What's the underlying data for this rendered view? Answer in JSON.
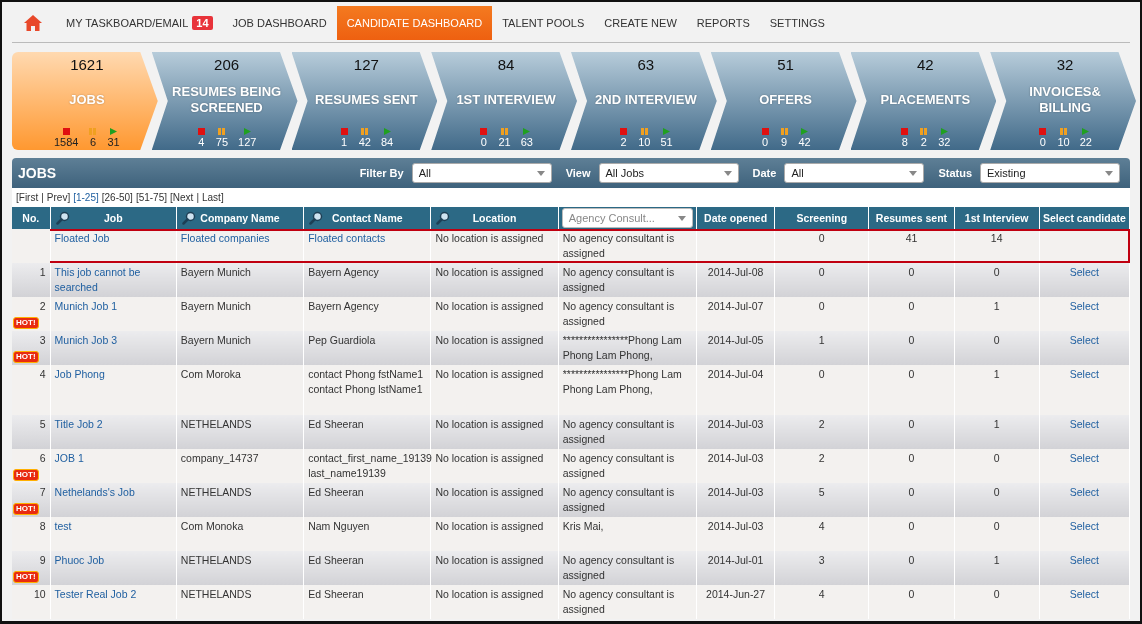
{
  "nav": {
    "items": [
      {
        "label": "MY TASKBOARD/EMAIL",
        "badge": "14",
        "selected": false
      },
      {
        "label": "JOB DASHBOARD",
        "selected": false
      },
      {
        "label": "CANDIDATE DASHBOARD",
        "selected": true
      },
      {
        "label": "TALENT POOLS",
        "selected": false
      },
      {
        "label": "CREATE NEW",
        "selected": false
      },
      {
        "label": "REPORTS",
        "selected": false
      },
      {
        "label": "SETTINGS",
        "selected": false
      }
    ]
  },
  "pipeline": [
    {
      "count": "1621",
      "label": "JOBS",
      "stopped": "1584",
      "paused": "6",
      "active": "31",
      "selected": true
    },
    {
      "count": "206",
      "label": "RESUMES BEING SCREENED",
      "stopped": "4",
      "paused": "75",
      "active": "127",
      "selected": false
    },
    {
      "count": "127",
      "label": "RESUMES SENT",
      "stopped": "1",
      "paused": "42",
      "active": "84",
      "selected": false
    },
    {
      "count": "84",
      "label": "1ST INTERVIEW",
      "stopped": "0",
      "paused": "21",
      "active": "63",
      "selected": false
    },
    {
      "count": "63",
      "label": "2ND INTERVIEW",
      "stopped": "2",
      "paused": "10",
      "active": "51",
      "selected": false
    },
    {
      "count": "51",
      "label": "OFFERS",
      "stopped": "0",
      "paused": "9",
      "active": "42",
      "selected": false
    },
    {
      "count": "42",
      "label": "PLACEMENTS",
      "stopped": "8",
      "paused": "2",
      "active": "32",
      "selected": false
    },
    {
      "count": "32",
      "label": "INVOICES& BILLING",
      "stopped": "0",
      "paused": "10",
      "active": "22",
      "selected": false
    }
  ],
  "panel": {
    "title": "JOBS",
    "filters": [
      {
        "label": "Filter By",
        "value": "All"
      },
      {
        "label": "View",
        "value": "All Jobs"
      },
      {
        "label": "Date",
        "value": "All"
      },
      {
        "label": "Status",
        "value": "Existing"
      }
    ],
    "pager": {
      "separator": "|",
      "items": [
        {
          "label": "[First",
          "selected": false
        },
        {
          "label": "Prev]",
          "selected": false
        },
        {
          "label": "[1-25]",
          "selected": true
        },
        {
          "label": "[26-50]",
          "selected": false
        },
        {
          "label": "[51-75]",
          "selected": false
        },
        {
          "label": "[Next",
          "selected": false
        },
        {
          "label": "Last]",
          "selected": false
        }
      ]
    },
    "table": {
      "columns": [
        {
          "label": "No.",
          "kind": "plain"
        },
        {
          "label": "Job",
          "kind": "search"
        },
        {
          "label": "Company Name",
          "kind": "search"
        },
        {
          "label": "Contact Name",
          "kind": "search"
        },
        {
          "label": "Location",
          "kind": "search"
        },
        {
          "label": "Agency Consult...",
          "kind": "dropdown"
        },
        {
          "label": "Date opened",
          "kind": "plain"
        },
        {
          "label": "Screening",
          "kind": "plain"
        },
        {
          "label": "Resumes sent",
          "kind": "plain"
        },
        {
          "label": "1st Interview",
          "kind": "plain"
        },
        {
          "label": "Select candidate",
          "kind": "plain"
        }
      ],
      "rows": [
        {
          "no": "",
          "job": "Floated Job",
          "company": "Floated companies",
          "company_link": true,
          "contact": "Floated contacts",
          "contact_link": true,
          "location": "No location is assigned",
          "consultant": "No agency consultant is assigned",
          "date": "",
          "screening": "0",
          "resumes_sent": "41",
          "first_interview": "14",
          "select": "",
          "highlighted": true
        },
        {
          "no": "1",
          "job": "This job cannot be searched",
          "company": "Bayern Munich",
          "contact": "Bayern Agency",
          "location": "No location is assigned",
          "consultant": "No agency consultant is assigned",
          "date": "2014-Jul-08",
          "screening": "0",
          "resumes_sent": "0",
          "first_interview": "0",
          "select": "Select",
          "highlighted": false
        },
        {
          "no": "2",
          "badge": "HOT!",
          "job": "Munich Job 1",
          "company": "Bayern Munich",
          "contact": "Bayern Agency",
          "location": "No location is assigned",
          "consultant": "No agency consultant is assigned",
          "date": "2014-Jul-07",
          "screening": "0",
          "resumes_sent": "0",
          "first_interview": "1",
          "select": "Select",
          "highlighted": false
        },
        {
          "no": "3",
          "badge": "HOT!",
          "job": "Munich Job 3",
          "company": "Bayern Munich",
          "contact": "Pep Guardiola",
          "location": "No location is assigned",
          "consultant": "****************Phong Lam Phong Lam Phong,",
          "date": "2014-Jul-05",
          "screening": "1",
          "resumes_sent": "0",
          "first_interview": "0",
          "select": "Select",
          "highlighted": false
        },
        {
          "no": "4",
          "job": "Job Phong",
          "company": "Com Moroka",
          "contact": "contact Phong fstName1 contact Phong lstName1",
          "location": "No location is assigned",
          "consultant": "****************Phong Lam Phong Lam Phong,",
          "date": "2014-Jul-04",
          "screening": "0",
          "resumes_sent": "0",
          "first_interview": "1",
          "select": "Select",
          "highlighted": false
        },
        {
          "no": "5",
          "job": "Title Job 2",
          "company": "NETHELANDS",
          "contact": "Ed Sheeran",
          "location": "No location is assigned",
          "consultant": "No agency consultant is assigned",
          "date": "2014-Jul-03",
          "screening": "2",
          "resumes_sent": "0",
          "first_interview": "1",
          "select": "Select",
          "highlighted": false
        },
        {
          "no": "6",
          "badge": "HOT!",
          "job": "JOB 1",
          "company": "company_14737",
          "contact": "contact_first_name_19139 last_name19139",
          "location": "No location is assigned",
          "consultant": "No agency consultant is assigned",
          "date": "2014-Jul-03",
          "screening": "2",
          "resumes_sent": "0",
          "first_interview": "0",
          "select": "Select",
          "highlighted": false
        },
        {
          "no": "7",
          "badge": "HOT!",
          "job": "Nethelands's Job",
          "company": "NETHELANDS",
          "contact": "Ed Sheeran",
          "location": "No location is assigned",
          "consultant": "No agency consultant is assigned",
          "date": "2014-Jul-03",
          "screening": "5",
          "resumes_sent": "0",
          "first_interview": "0",
          "select": "Select",
          "highlighted": false
        },
        {
          "no": "8",
          "job": "test",
          "company": "Com Monoka",
          "contact": "Nam Nguyen",
          "location": "No location is assigned",
          "consultant": "Kris Mai,",
          "date": "2014-Jul-03",
          "screening": "4",
          "resumes_sent": "0",
          "first_interview": "0",
          "select": "Select",
          "highlighted": false
        },
        {
          "no": "9",
          "badge": "HOT!",
          "job": "Phuoc Job",
          "company": "NETHELANDS",
          "contact": "Ed Sheeran",
          "location": "No location is assigned",
          "consultant": "No agency consultant is assigned",
          "date": "2014-Jul-01",
          "screening": "3",
          "resumes_sent": "0",
          "first_interview": "1",
          "select": "Select",
          "highlighted": false
        },
        {
          "no": "10",
          "job": "Tester Real Job 2",
          "company": "NETHELANDS",
          "contact": "Ed Sheeran",
          "location": "No location is assigned",
          "consultant": "No agency consultant is assigned",
          "date": "2014-Jun-27",
          "screening": "4",
          "resumes_sent": "0",
          "first_interview": "0",
          "select": "Select",
          "highlighted": false
        }
      ]
    }
  }
}
